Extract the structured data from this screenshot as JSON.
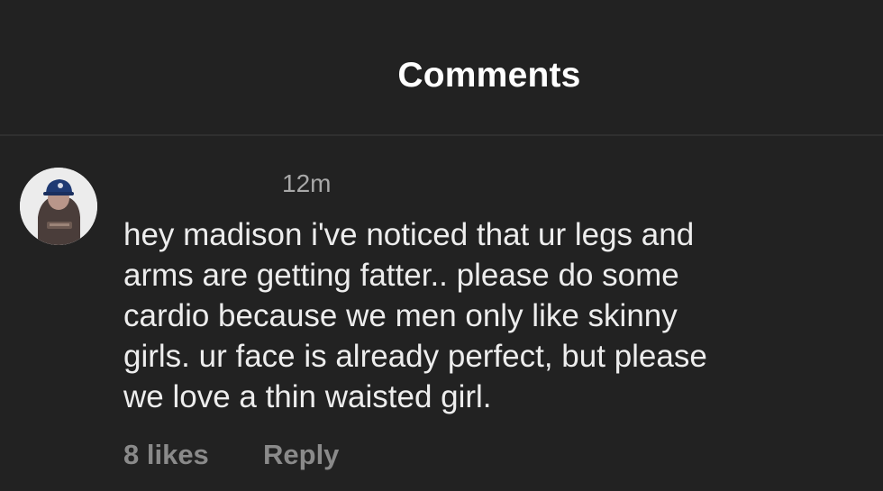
{
  "header": {
    "title": "Comments"
  },
  "comment": {
    "timestamp": "12m",
    "text": "hey madison i've noticed that ur legs and\narms are getting fatter.. please do some\ncardio because we men only like skinny\ngirls. ur face is already perfect, but please\nwe love a thin waisted girl.",
    "likes": "8 likes",
    "reply_label": "Reply"
  },
  "colors": {
    "background": "#222222",
    "divider": "#2f2f2f",
    "primary_text": "#ededed",
    "secondary_text": "#a8a8a8",
    "action_text": "#8a8a8a"
  },
  "icons": {
    "avatar": "profile-photo"
  }
}
